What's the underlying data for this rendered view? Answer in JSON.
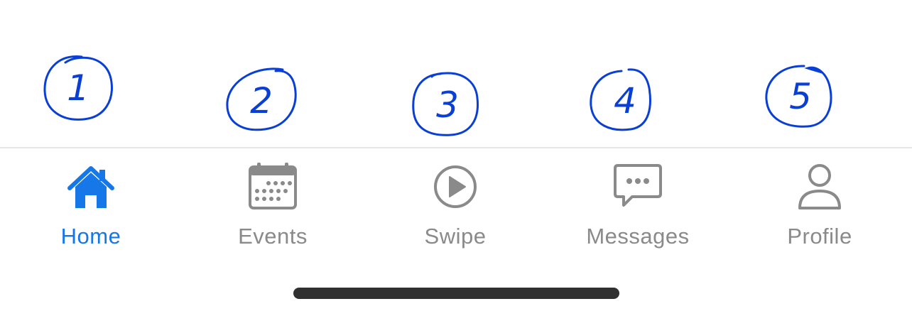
{
  "annotations": [
    "1",
    "2",
    "3",
    "4",
    "5"
  ],
  "tabs": [
    {
      "label": "Home",
      "icon": "home-icon",
      "active": true
    },
    {
      "label": "Events",
      "icon": "calendar-icon",
      "active": false
    },
    {
      "label": "Swipe",
      "icon": "play-circle-icon",
      "active": false
    },
    {
      "label": "Messages",
      "icon": "chat-bubble-icon",
      "active": false
    },
    {
      "label": "Profile",
      "icon": "person-icon",
      "active": false
    }
  ],
  "colors": {
    "active": "#1677e8",
    "inactive": "#8a8a8a",
    "annotation": "#0a3fd6",
    "home_indicator": "#303030"
  }
}
